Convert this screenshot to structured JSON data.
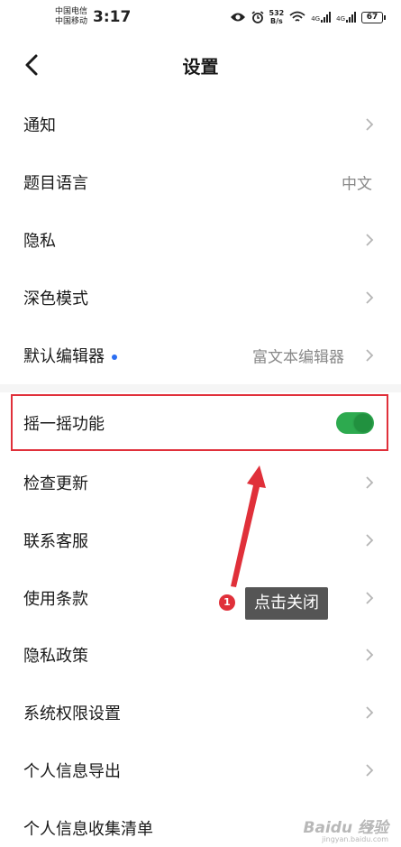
{
  "status_bar": {
    "carrier_1": "中国电信",
    "carrier_2": "中国移动",
    "time": "3:17",
    "net_speed_value": "532",
    "net_speed_unit": "B/s",
    "signal_label_1": "4G",
    "signal_label_2": "4G",
    "battery": "67"
  },
  "header": {
    "title": "设置"
  },
  "rows": [
    {
      "label": "通知",
      "value": ""
    },
    {
      "label": "题目语言",
      "value": "中文"
    },
    {
      "label": "隐私",
      "value": ""
    },
    {
      "label": "深色模式",
      "value": ""
    },
    {
      "label": "默认编辑器",
      "value": "富文本编辑器"
    },
    {
      "label": "摇一摇功能",
      "toggle_on": true
    },
    {
      "label": "检查更新",
      "value": ""
    },
    {
      "label": "联系客服",
      "value": ""
    },
    {
      "label": "使用条款",
      "value": ""
    },
    {
      "label": "隐私政策",
      "value": ""
    },
    {
      "label": "系统权限设置",
      "value": ""
    },
    {
      "label": "个人信息导出",
      "value": ""
    },
    {
      "label": "个人信息收集清单",
      "value": ""
    }
  ],
  "annotation": {
    "step_number": "1",
    "callout_text": "点击关闭",
    "highlight_color": "#e0303a"
  },
  "watermark": {
    "brand": "Baidu 经验",
    "domain": "jingyan.baidu.com"
  },
  "colors": {
    "toggle_on": "#2daa4f",
    "badge_dot": "#2b6ef2",
    "annotation_red": "#e0303a"
  },
  "icons": {
    "back": "chevron-left-icon",
    "row_arrow": "chevron-right-icon"
  }
}
